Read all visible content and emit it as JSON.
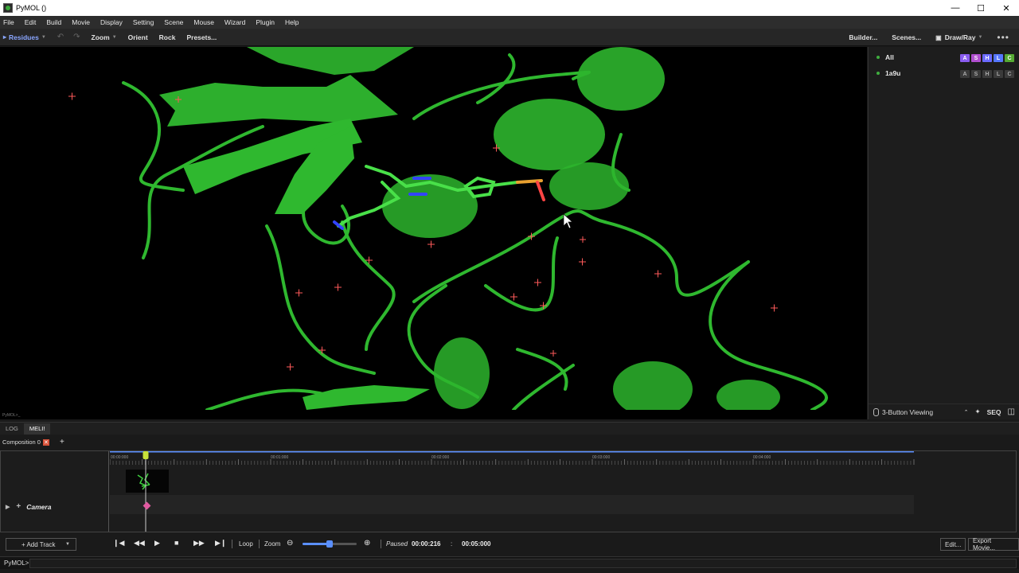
{
  "window": {
    "title": "PyMOL ()",
    "controls": [
      "—",
      "☐",
      "✕"
    ]
  },
  "menu": [
    "File",
    "Edit",
    "Build",
    "Movie",
    "Display",
    "Setting",
    "Scene",
    "Mouse",
    "Wizard",
    "Plugin",
    "Help"
  ],
  "toolbar": {
    "selection_mode": "Residues",
    "zoom": "Zoom",
    "orient": "Orient",
    "rock": "Rock",
    "presets": "Presets...",
    "builder": "Builder...",
    "scenes": "Scenes...",
    "draw_ray": "Draw/Ray",
    "more": "•••"
  },
  "objects": [
    {
      "name": "All",
      "buttons": [
        "A",
        "S",
        "H",
        "L",
        "C"
      ],
      "colored": true
    },
    {
      "name": "1a9u",
      "buttons": [
        "A",
        "S",
        "H",
        "L",
        "C"
      ],
      "colored": false
    }
  ],
  "object_button_colors": {
    "A": "#8a5cf0",
    "S": "#b04fcf",
    "H": "#6b6bff",
    "L": "#5577ff",
    "C": "#55aa33"
  },
  "panel_bottom": {
    "mouse_mode": "3-Button Viewing",
    "seq": "SEQ"
  },
  "viewport_status": "PyMOL>_",
  "lower_tabs": [
    "LOG",
    "MELI!"
  ],
  "active_lower_tab": "MELI!",
  "composition": {
    "tab": "Composition 0",
    "close": "✕",
    "add": "+"
  },
  "timeline": {
    "ticks": [
      "00:00:000",
      "00:01:000",
      "00:02:000",
      "00:03:000",
      "00:04:000"
    ],
    "track": "Camera",
    "playhead_time_s": 0.216,
    "duration_s": 5.0
  },
  "playback": {
    "add_track": "+ Add Track",
    "loop": "Loop",
    "zoom": "Zoom",
    "status": "Paused",
    "current_time": "00:00:216",
    "separator": ":",
    "end_time": "00:05:000",
    "zoom_level": 0.5,
    "edit": "Edit...",
    "export": "Export Movie..."
  },
  "command_line": {
    "prompt": "PyMOL>"
  },
  "colors": {
    "protein": "#2fb82f",
    "accent": "#5a8fff",
    "water": "#ff5a5a",
    "playhead": "#c8e23a",
    "keyframe": "#e05aa0"
  }
}
